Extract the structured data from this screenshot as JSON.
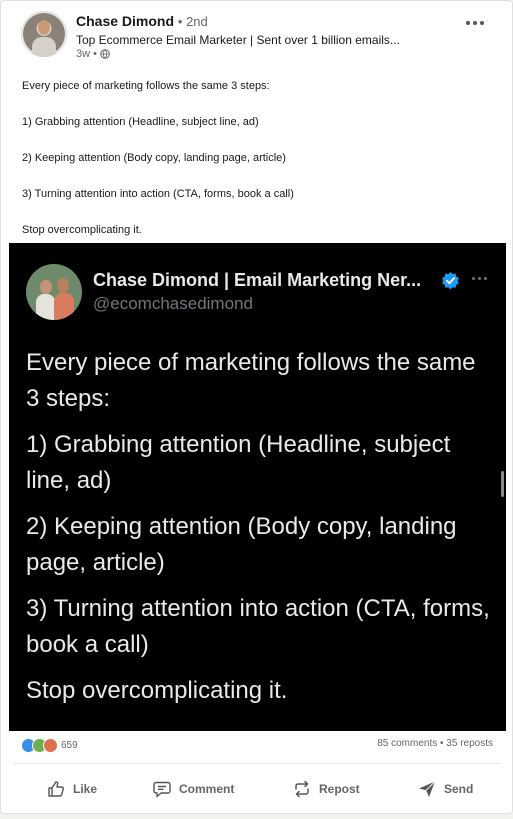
{
  "post": {
    "author_name": "Chase Dimond",
    "degree": "• 2nd",
    "headline": "Top Ecommerce Email Marketer | Sent over 1 billion emails...",
    "time": "3w •",
    "lines": [
      "Every piece of marketing follows the same 3 steps:",
      "1) Grabbing attention (Headline, subject line, ad)",
      "2) Keeping attention (Body copy, landing page, article)",
      "3) Turning attention into action (CTA, forms, book a call)",
      "Stop overcomplicating it."
    ]
  },
  "tweet": {
    "name": "Chase Dimond | Email Marketing Ner...",
    "handle": "@ecomchasedimond",
    "paragraphs": [
      "Every piece of marketing follows the same 3 steps:",
      "1) Grabbing attention (Headline, subject line, ad)",
      "2) Keeping attention (Body copy, landing page, article)",
      "3) Turning attention into action (CTA, forms, book a call)",
      "Stop overcomplicating it."
    ],
    "verified_color": "#1d9bf0"
  },
  "social": {
    "reaction_count": "659",
    "stats": "85 comments • 35 reposts"
  },
  "actions": {
    "like": "Like",
    "comment": "Comment",
    "repost": "Repost",
    "send": "Send"
  }
}
